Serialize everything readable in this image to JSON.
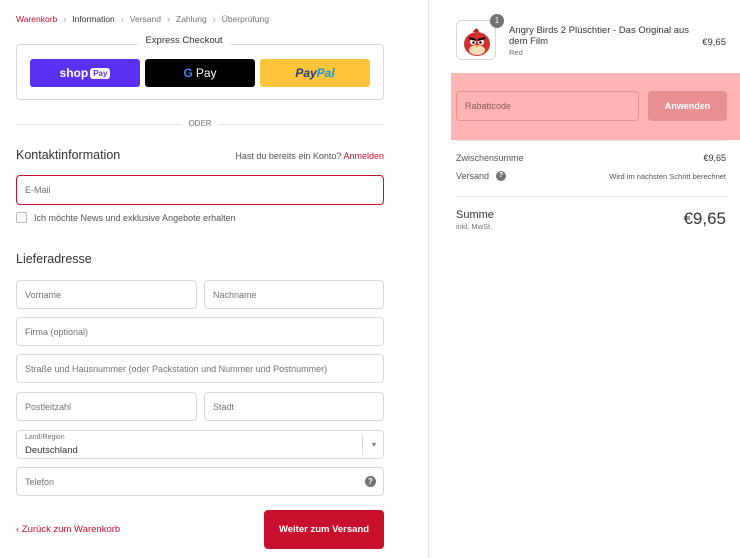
{
  "breadcrumb": {
    "cart": "Warenkorb",
    "information": "Information",
    "shipping": "Versand",
    "payment": "Zahlung",
    "review": "Überprüfung",
    "separator": "›"
  },
  "express": {
    "title": "Express Checkout",
    "shop_label": "shop",
    "shop_pay_tag": "Pay",
    "gpay_g": "G",
    "gpay_label": "Pay",
    "paypal_pay": "Pay",
    "paypal_pal": "Pal"
  },
  "divider": {
    "text": "ODER"
  },
  "contact": {
    "title": "Kontaktinformation",
    "login_prompt": "Hast du bereits ein Konto?",
    "login_link": "Anmelden",
    "email_placeholder": "E-Mail",
    "newsletter_label": "Ich möchte News und exklusive Angebote erhalten"
  },
  "shipping": {
    "title": "Lieferadresse",
    "first_name_placeholder": "Vorname",
    "last_name_placeholder": "Nachname",
    "company_placeholder": "Firma (optional)",
    "street_placeholder": "Straße und Hausnummer (oder Packstation und Nummer und Postnummer)",
    "zip_placeholder": "Postleitzahl",
    "city_placeholder": "Stadt",
    "country_label": "Land/Region",
    "country_value": "Deutschland",
    "phone_placeholder": "Telefon"
  },
  "actions": {
    "back_label": "‹ Zurück zum Warenkorb",
    "continue_label": "Weiter zum Versand"
  },
  "order": {
    "quantity": "1",
    "product_name": "Angry Birds 2 Plüschtier - Das Original aus dem Film",
    "variant": "Red",
    "price": "€9,65",
    "discount_placeholder": "Rabattcode",
    "apply_label": "Anwenden",
    "subtotal_label": "Zwischensumme",
    "subtotal_value": "€9,65",
    "shipping_label": "Versand",
    "shipping_note": "Wird im nächsten Schritt berechnet",
    "total_label": "Summe",
    "total_sub": "inkl. MwSt.",
    "total_value": "€9,65"
  },
  "colors": {
    "accent": "#c8102e",
    "shop_pay": "#5a31f4",
    "paypal_yellow": "#ffc439",
    "discount_highlight": "#ffb3b3"
  },
  "icons": {
    "help": "?",
    "chevron_down": "▾",
    "product_image": "red-bird-plush"
  }
}
